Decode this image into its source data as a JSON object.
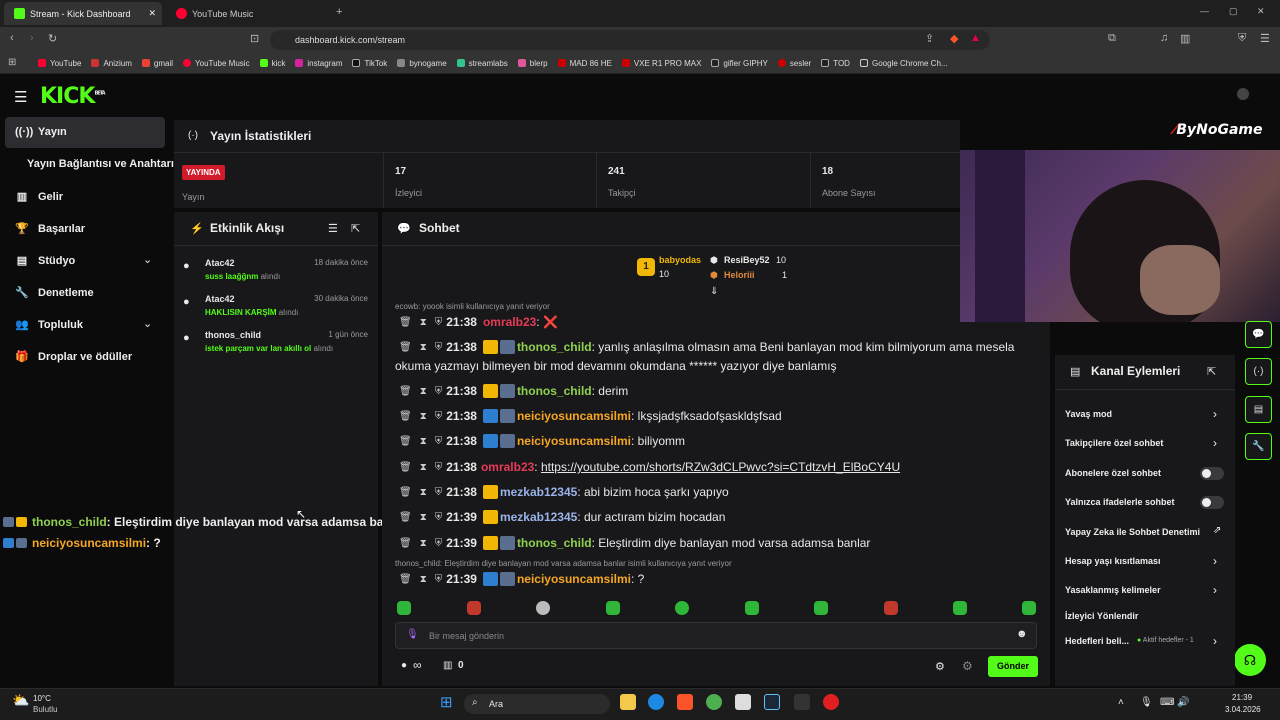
{
  "browser": {
    "tabs": [
      {
        "label": "Stream - Kick Dashboard"
      },
      {
        "label": "YouTube Music"
      }
    ],
    "url": "dashboard.kick.com/stream",
    "bookmarks": [
      "YouTube",
      "Anizium",
      "gmail",
      "YouTube Music",
      "kick",
      "instagram",
      "TikTok",
      "bynogame",
      "streamlabs",
      "blerp",
      "MAD 86 HE",
      "VXE R1 PRO MAX",
      "gifler GIPHY",
      "sesler",
      "TOD",
      "Google Chrome Ch..."
    ]
  },
  "kick": {
    "logo": "KICK",
    "logo_tag": "BETA"
  },
  "sidebar": {
    "items": [
      {
        "label": "Yayın"
      },
      {
        "label": "Yayın Bağlantısı ve Anahtarı"
      },
      {
        "label": "Gelir"
      },
      {
        "label": "Başarılar"
      },
      {
        "label": "Stüdyo"
      },
      {
        "label": "Denetleme"
      },
      {
        "label": "Topluluk"
      },
      {
        "label": "Droplar ve ödüller"
      }
    ]
  },
  "stats": {
    "title": "Yayın İstatistikleri",
    "live_badge": "YAYINDA",
    "live_label": "Yayın",
    "viewers_value": "17",
    "viewers_label": "İzleyici",
    "followers_value": "241",
    "followers_label": "Takipçi",
    "subs_value": "18",
    "subs_label": "Abone Sayısı"
  },
  "activity": {
    "title": "Etkinlik Akışı",
    "items": [
      {
        "user": "Atac42",
        "time": "18 dakika önce",
        "reward": "suss laağğnm",
        "suffix": "alındı"
      },
      {
        "user": "Atac42",
        "time": "30 dakika önce",
        "reward": "HAKLISIN KARŞİM",
        "suffix": "alındı"
      },
      {
        "user": "thonos_child",
        "time": "1 gün önce",
        "reward": "istek parçam var lan akıllı ol",
        "suffix": "alındı"
      }
    ]
  },
  "overlay_chat": [
    {
      "user": "thonos_child",
      "text": ": Eleştirdim diye banlayan mod varsa adamsa banlar"
    },
    {
      "user": "neiciyosuncamsilmi",
      "text": ": ?"
    }
  ],
  "chat": {
    "title": "Sohbet",
    "top_gifters": [
      {
        "name": "babyodas",
        "count": "10"
      },
      {
        "name": "ResiBey52",
        "count": "10"
      },
      {
        "name": "Heloriii",
        "count": "1"
      }
    ],
    "reply_note_1": "ecowb: yoook isimli kullanıcıya yanıt veriyor",
    "reply_note_2": "thonos_child: Eleştirdim diye banlayan mod varsa adamsa banlar isimli kullanıcıya yanıt veriyor",
    "messages": [
      {
        "time": "21:38",
        "user": "omralb23",
        "text": "❌"
      },
      {
        "time": "21:38",
        "user": "thonos_child",
        "text": "yanlış anlaşılma olmasın ama Beni banlayan mod kim bilmiyorum ama mesela",
        "text2": "okuma yazmayı bilmeyen bir mod devamını okumdana ****** yazıyor diye banlamış"
      },
      {
        "time": "21:38",
        "user": "thonos_child",
        "text": "derim"
      },
      {
        "time": "21:38",
        "user": "neiciyosuncamsilmi",
        "text": "lkşsjadşfksadofşaskldşfsad"
      },
      {
        "time": "21:38",
        "user": "neiciyosuncamsilmi",
        "text": "biliyomm"
      },
      {
        "time": "21:38",
        "user": "omralb23",
        "text": "https://youtube.com/shorts/RZw3dCLPwvc?si=CTdtzvH_ElBoCY4U"
      },
      {
        "time": "21:38",
        "user": "mezkab12345",
        "text": "abi bizim hoca şarkı yapıyo"
      },
      {
        "time": "21:39",
        "user": "mezkab12345",
        "text": "dur actıram bizim hocadan"
      },
      {
        "time": "21:39",
        "user": "thonos_child",
        "text": "Eleştirdim diye banlayan mod varsa adamsa banlar"
      },
      {
        "time": "21:39",
        "user": "neiciyosuncamsilmi",
        "text": "?"
      }
    ],
    "input_placeholder": "Bir mesaj gönderin",
    "send_label": "Gönder",
    "viewer_count": "∞",
    "pinned_count": "0"
  },
  "actions": {
    "title": "Kanal Eylemleri",
    "items": [
      {
        "label": "Yavaş mod"
      },
      {
        "label": "Takipçilere özel sohbet"
      },
      {
        "label": "Abonelere özel sohbet"
      },
      {
        "label": "Yalnızca ifadelerle sohbet"
      },
      {
        "label": "Yapay Zeka ile Sohbet Denetimi"
      },
      {
        "label": "Hesap yaşı kısıtlaması"
      },
      {
        "label": "Yasaklanmış kelimeler"
      },
      {
        "label": "İzleyici Yönlendir"
      },
      {
        "label": "Hedefleri beli..."
      }
    ],
    "goals_status": "Aktif hedefler - 1"
  },
  "stream_overlay_logo": "ByNoGame",
  "taskbar": {
    "weather_temp": "10°C",
    "weather_desc": "Bulutlu",
    "search": "Ara",
    "clock_time": "21:39",
    "clock_date": "3.04.2026"
  },
  "colors": {
    "kick_green": "#53fc18",
    "live_red": "#d11a2a",
    "crown": "#f2b705"
  }
}
